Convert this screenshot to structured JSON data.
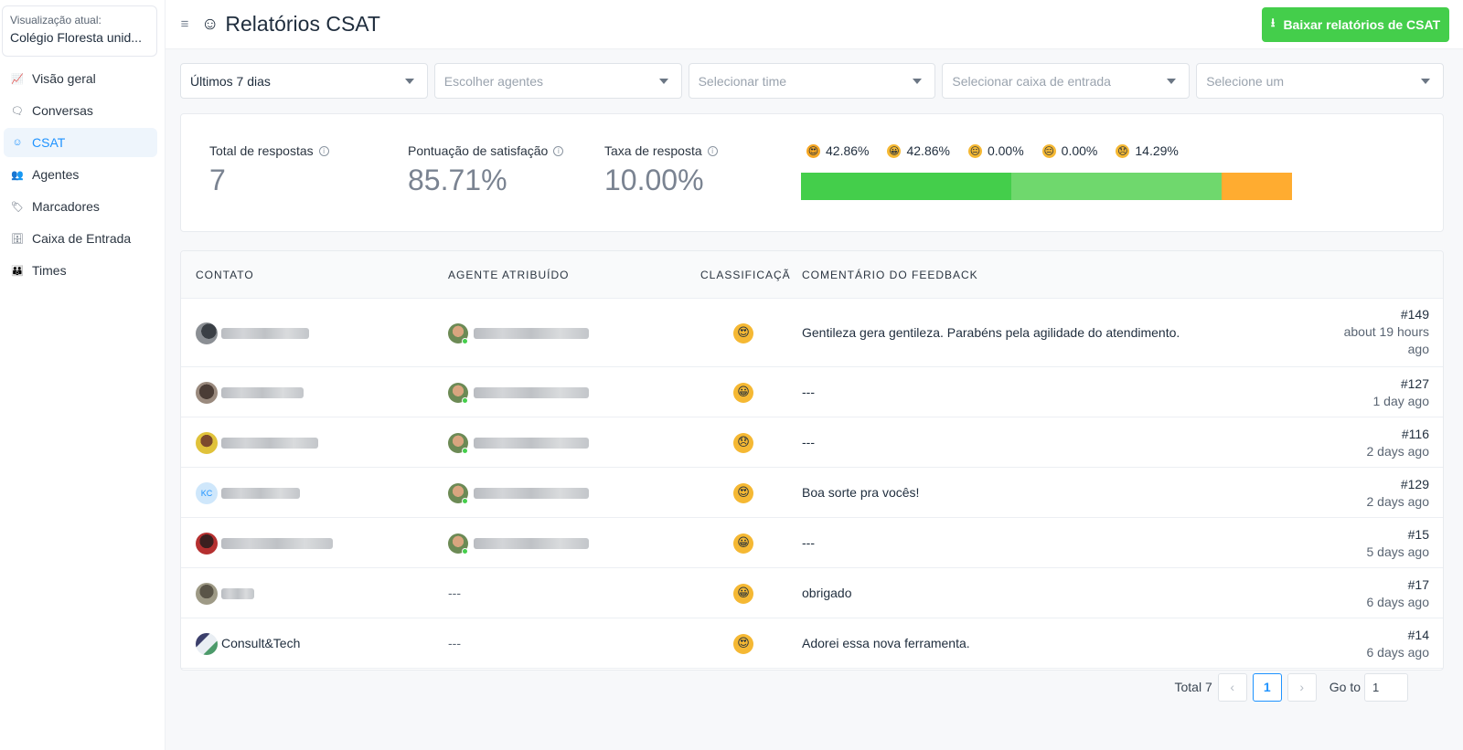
{
  "sidebar": {
    "view_caption": "Visualização atual:",
    "view_name": "Colégio Floresta unid...",
    "items": [
      {
        "label": "Visão geral",
        "icon": "chart-line-icon",
        "glyph": "📈"
      },
      {
        "label": "Conversas",
        "icon": "chat-bubble-icon",
        "glyph": "🗨"
      },
      {
        "label": "CSAT",
        "icon": "smiley-icon",
        "glyph": "☺",
        "active": true
      },
      {
        "label": "Agentes",
        "icon": "people-icon",
        "glyph": "👥"
      },
      {
        "label": "Marcadores",
        "icon": "tag-icon",
        "glyph": "🏷"
      },
      {
        "label": "Caixa de Entrada",
        "icon": "inbox-icon",
        "glyph": "🗄"
      },
      {
        "label": "Times",
        "icon": "teams-icon",
        "glyph": "👪"
      }
    ]
  },
  "header": {
    "title": "Relatórios CSAT",
    "download_label": "Baixar relatórios de CSAT"
  },
  "filters": [
    {
      "text": "Últimos 7 dias",
      "placeholder": false
    },
    {
      "text": "Escolher agentes",
      "placeholder": true
    },
    {
      "text": "Selecionar time",
      "placeholder": true
    },
    {
      "text": "Selecionar caixa de entrada",
      "placeholder": true
    },
    {
      "text": "Selecione um",
      "placeholder": true
    }
  ],
  "metrics": {
    "total_label": "Total de respostas",
    "total_value": "7",
    "satisfaction_label": "Pontuação de satisfação",
    "satisfaction_value": "85.71%",
    "response_rate_label": "Taxa de resposta",
    "response_rate_value": "10.00%"
  },
  "rating_distribution": [
    {
      "emoji": "😍",
      "label": "42.86%",
      "percent": 42.86,
      "color": "#44ce4b",
      "emoji_bg": "#f5a623"
    },
    {
      "emoji": "😀",
      "label": "42.86%",
      "percent": 42.86,
      "color": "#6fd86d",
      "emoji_bg": "#f5b833"
    },
    {
      "emoji": "😐",
      "label": "0.00%",
      "percent": 0,
      "color": "#ffc532",
      "emoji_bg": "#f5b833"
    },
    {
      "emoji": "😑",
      "label": "0.00%",
      "percent": 0,
      "color": "#ff9a33",
      "emoji_bg": "#f5b833"
    },
    {
      "emoji": "😞",
      "label": "14.29%",
      "percent": 14.29,
      "color": "#ffac30",
      "emoji_bg": "#f5b833"
    }
  ],
  "table": {
    "headers": {
      "contact": "CONTATO",
      "agent": "AGENTE ATRIBUÍDO",
      "rating": "CLASSIFICAÇÃ",
      "feedback": "COMENTÁRIO DO FEEDBACK"
    },
    "rows": [
      {
        "contact_name": "",
        "has_agent": true,
        "emoji": "😍",
        "feedback": "Gentileza gera gentileza. Parabéns pela agilidade do atendimento.",
        "conv_id": "#149",
        "time": "about 19 hours ago"
      },
      {
        "contact_name": "",
        "has_agent": true,
        "emoji": "😀",
        "feedback": "---",
        "conv_id": "#127",
        "time": "1 day ago"
      },
      {
        "contact_name": "",
        "has_agent": true,
        "emoji": "😞",
        "feedback": "---",
        "conv_id": "#116",
        "time": "2 days ago"
      },
      {
        "contact_name": "",
        "avatar_initials": "KC",
        "has_agent": true,
        "emoji": "😍",
        "feedback": "Boa sorte pra vocês!",
        "conv_id": "#129",
        "time": "2 days ago"
      },
      {
        "contact_name": "",
        "has_agent": true,
        "emoji": "😀",
        "feedback": "---",
        "conv_id": "#15",
        "time": "5 days ago"
      },
      {
        "contact_name": "",
        "has_agent": false,
        "agent_text": "---",
        "emoji": "😀",
        "feedback": "obrigado",
        "conv_id": "#17",
        "time": "6 days ago"
      },
      {
        "contact_name": "Consult&Tech",
        "has_agent": false,
        "agent_text": "---",
        "emoji": "😍",
        "feedback": "Adorei essa nova ferramenta.",
        "conv_id": "#14",
        "time": "6 days ago"
      }
    ]
  },
  "pagination": {
    "total_label": "Total 7",
    "current_page": "1",
    "goto_label": "Go to",
    "goto_value": "1",
    "prev_glyph": "‹",
    "next_glyph": "›"
  }
}
